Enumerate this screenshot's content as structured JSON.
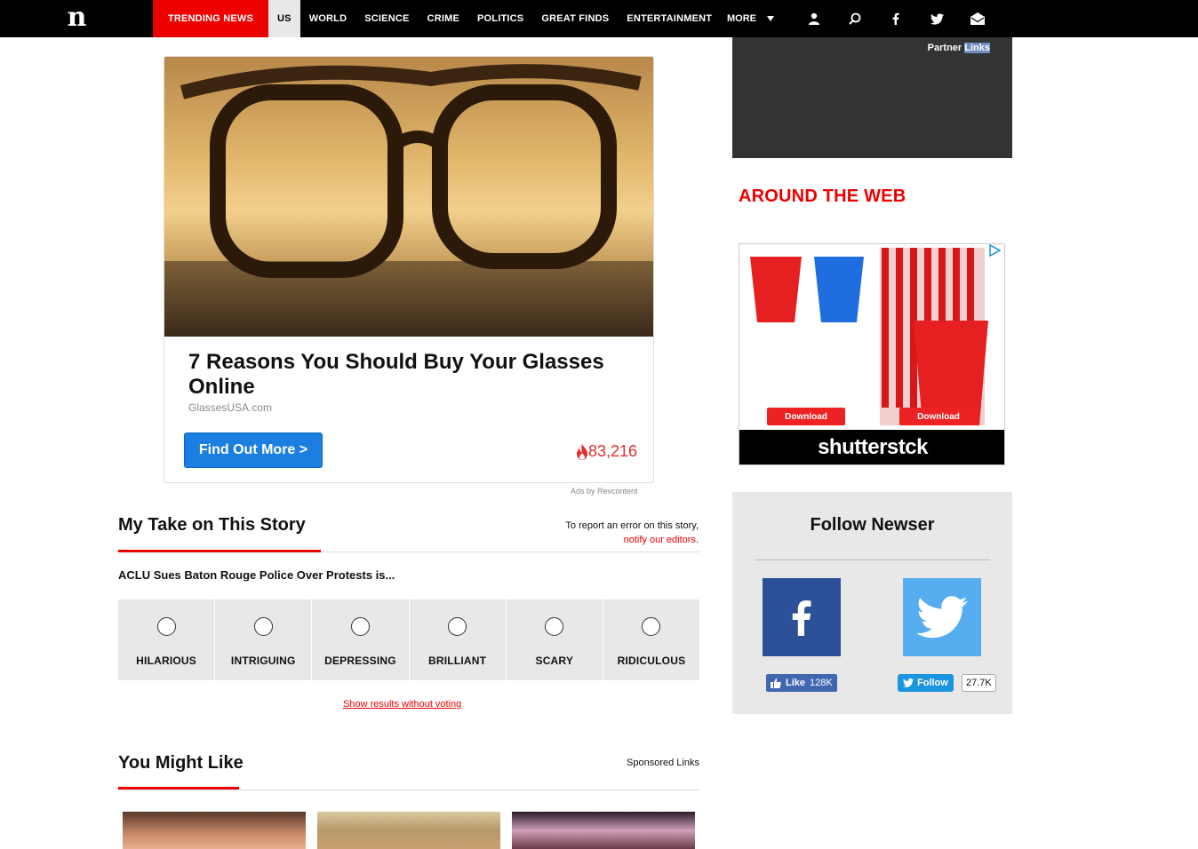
{
  "nav": {
    "logo": "n",
    "trending": "TRENDING NEWS",
    "links": [
      "US",
      "WORLD",
      "SCIENCE",
      "CRIME",
      "POLITICS",
      "GREAT FINDS",
      "ENTERTAINMENT"
    ],
    "more": "MORE",
    "icons": [
      "user-icon",
      "search-icon",
      "facebook-icon",
      "twitter-icon",
      "mail-icon"
    ]
  },
  "ad": {
    "title": "7 Reasons You Should Buy Your Glasses Online",
    "source": "GlassesUSA.com",
    "button": "Find Out More >",
    "count": "83,216",
    "credit": "Ads by Revcontent"
  },
  "mytake": {
    "title": "My Take on This Story",
    "report_line1": "To report an error on this story,",
    "report_link": "notify our editors",
    "report_end": ".",
    "question": "ACLU Sues Baton Rouge Police Over Protests is...",
    "options": [
      "HILARIOUS",
      "INTRIGUING",
      "DEPRESSING",
      "BRILLIANT",
      "SCARY",
      "RIDICULOUS"
    ],
    "show_results": "Show results without voting"
  },
  "yml": {
    "title": "You Might Like",
    "sponsored": "Sponsored Links"
  },
  "sidebar": {
    "partner_a": "Partner",
    "partner_b": "Links",
    "around": "AROUND THE WEB",
    "ss_download": "Download",
    "ss_brand": "shutterstck",
    "follow_title": "Follow Newser",
    "fb_like": "Like",
    "fb_count": "128K",
    "tw_follow": "Follow",
    "tw_count": "27.7K"
  },
  "colors": {
    "accent": "#e00000",
    "facebook": "#2d5198",
    "twitter": "#55acee",
    "ad_button": "#1a7fe0"
  }
}
